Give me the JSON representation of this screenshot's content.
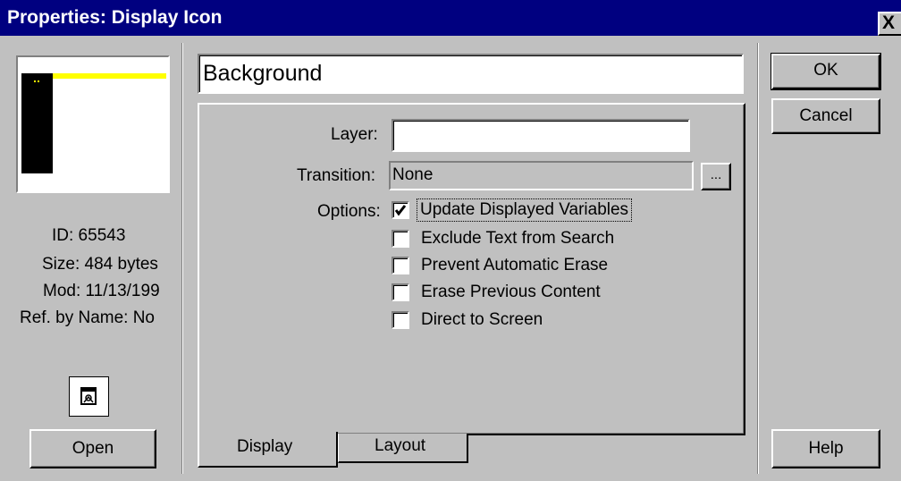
{
  "window": {
    "title": "Properties: Display Icon",
    "close_label": "X"
  },
  "left_panel": {
    "id_text": "ID: 65543",
    "size_text": "Size: 484 bytes",
    "mod_text": "Mod: 11/13/199",
    "ref_text": "Ref. by Name: No",
    "open_label": "Open"
  },
  "main": {
    "name_value": "Background",
    "layer_label": "Layer:",
    "layer_value": "",
    "transition_label": "Transition:",
    "transition_value": "None",
    "transition_button": "...",
    "options_label": "Options:",
    "options": [
      {
        "label": "Update Displayed Variables",
        "checked": true
      },
      {
        "label": "Exclude Text from Search",
        "checked": false
      },
      {
        "label": "Prevent Automatic Erase",
        "checked": false
      },
      {
        "label": "Erase Previous Content",
        "checked": false
      },
      {
        "label": "Direct to Screen",
        "checked": false
      }
    ],
    "tabs": [
      {
        "label": "Display",
        "active": true
      },
      {
        "label": "Layout",
        "active": false
      }
    ]
  },
  "buttons": {
    "ok": "OK",
    "cancel": "Cancel",
    "help": "Help"
  },
  "icons": {
    "display_icon": "display-icon",
    "close": "close-icon",
    "check": "checkmark-icon"
  },
  "colors": {
    "titlebar": "#000080",
    "face": "#c0c0c0",
    "preview_bar": "#ffff00"
  }
}
